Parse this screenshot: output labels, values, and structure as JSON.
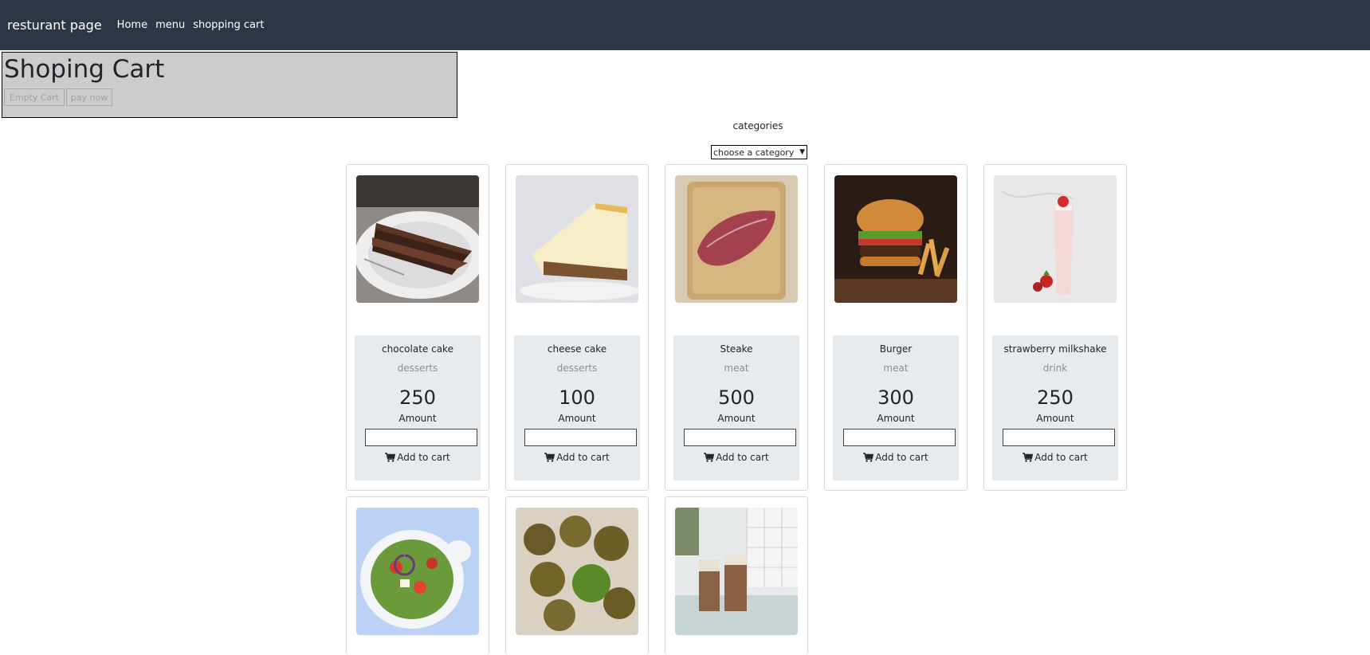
{
  "navbar": {
    "brand": "resturant page",
    "links": [
      "Home",
      "menu",
      "shopping cart"
    ]
  },
  "cart": {
    "title": "Shoping Cart",
    "empty_label": "Empty Cart",
    "pay_label": "pay now"
  },
  "categories": {
    "label": "categories",
    "selected": "choose a category"
  },
  "products": [
    {
      "name": "chocolate cake",
      "category": "desserts",
      "price": "250",
      "amount_label": "Amount",
      "add_label": "Add to cart",
      "image": "chocolate-cake-photo"
    },
    {
      "name": "cheese cake",
      "category": "desserts",
      "price": "100",
      "amount_label": "Amount",
      "add_label": "Add to cart",
      "image": "cheese-cake-photo"
    },
    {
      "name": "Steake",
      "category": "meat",
      "price": "500",
      "amount_label": "Amount",
      "add_label": "Add to cart",
      "image": "steak-photo"
    },
    {
      "name": "Burger",
      "category": "meat",
      "price": "300",
      "amount_label": "Amount",
      "add_label": "Add to cart",
      "image": "burger-photo"
    },
    {
      "name": "strawberry milkshake",
      "category": "drink",
      "price": "250",
      "amount_label": "Amount",
      "add_label": "Add to cart",
      "image": "milkshake-photo"
    },
    {
      "image": "salad-photo"
    },
    {
      "image": "falafel-photo"
    },
    {
      "image": "coffee-photo"
    }
  ],
  "colors": {
    "navbar": "#2c3746",
    "cart_box": "#cccccc",
    "card_body": "#e7ebee"
  }
}
